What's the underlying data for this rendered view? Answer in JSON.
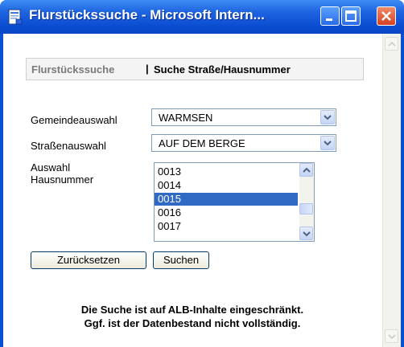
{
  "window": {
    "title": "Flurstückssuche - Microsoft Intern..."
  },
  "tabs": {
    "first": "Flurstückssuche",
    "separator": "|",
    "second": "Suche Straße/Hausnummer"
  },
  "form": {
    "gemeinde_label": "Gemeindeauswahl",
    "gemeinde_value": "WARMSEN",
    "strasse_label": "Straßenauswahl",
    "strasse_value": "AUF DEM BERGE",
    "hausnummer_label_1": "Auswahl",
    "hausnummer_label_2": "Hausnummer",
    "hausnummern": [
      "0013",
      "0014",
      "0015",
      "0016",
      "0017"
    ],
    "selected_hausnummer": "0015"
  },
  "buttons": {
    "reset": "Zurücksetzen",
    "search": "Suchen"
  },
  "notice": {
    "line1": "Die Suche ist auf ALB-Inhalte eingeschränkt.",
    "line2": "Ggf. ist der Datenbestand nicht vollständig."
  },
  "colors": {
    "titlebar": "#0a4cd0",
    "selection": "#316ac5",
    "close_button": "#d6421f"
  }
}
